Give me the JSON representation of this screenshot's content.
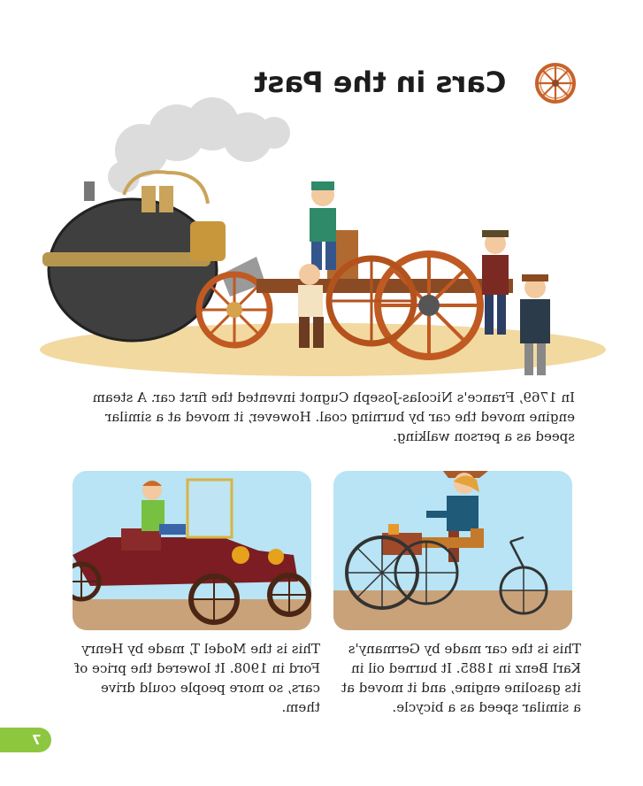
{
  "header": {
    "title": "Cars in the Past",
    "icon": "wagon-wheel-icon"
  },
  "hero": {
    "caption": "In 1769, France's Nicolas-Joseph Cugnot invented the first car. A steam engine moved the car by burning coal. However, it moved at a similar speed as a person walking."
  },
  "cards": [
    {
      "image": "ford-model-t-illustration",
      "caption": "This is the Model T, made by Henry Ford in 1908. It lowered the price of cars, so more people could drive them."
    },
    {
      "image": "benz-motorwagen-illustration",
      "caption": "This is the car made by Germany's Karl Benz in 1885. It burned oil in its gasoline engine, and it moved at a similar speed as a bicycle."
    }
  ],
  "footer": {
    "page_number": "7"
  },
  "colors": {
    "accent_green": "#8dc63f",
    "wheel_orange": "#c8622b",
    "sky_blue": "#b8e4f5",
    "ground_tan": "#c9a27a"
  }
}
